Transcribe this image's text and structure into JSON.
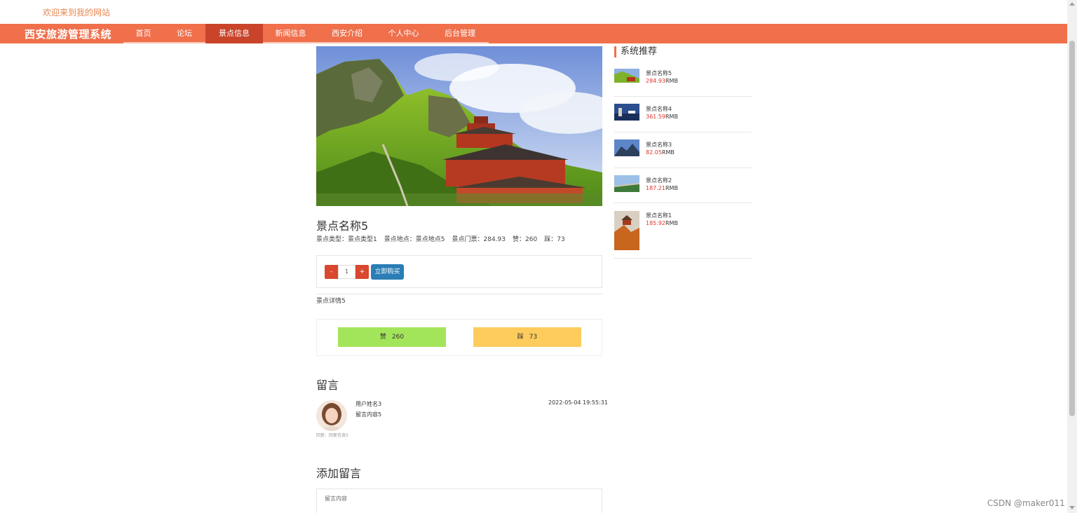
{
  "header": {
    "welcome": "欢迎来到我的网站",
    "brand": "西安旅游管理系统"
  },
  "nav": {
    "items": [
      {
        "label": "首页",
        "width": 57
      },
      {
        "label": "论坛",
        "width": 60
      },
      {
        "label": "景点信息",
        "width": 82,
        "active": true
      },
      {
        "label": "新闻信息",
        "width": 79
      },
      {
        "label": "西安介绍",
        "width": 82
      },
      {
        "label": "个人中心",
        "width": 79
      },
      {
        "label": "后台管理",
        "width": 82
      }
    ]
  },
  "spot": {
    "title": "景点名称5",
    "type_label": "景点类型：",
    "type_value": "景点类型1",
    "location_label": "景点地点：",
    "location_value": "景点地点5",
    "ticket_label": "景点门票：",
    "ticket_value": "284.93",
    "like_label": "赞：",
    "like_value": "260",
    "dislike_label": "踩：",
    "dislike_value": "73",
    "detail": "景点详情5"
  },
  "buy": {
    "minus": "-",
    "qty": "1",
    "plus": "+",
    "buy_label": "立即购买"
  },
  "vote": {
    "like_label": "赞",
    "like_count": "260",
    "dislike_label": "踩",
    "dislike_count": "73"
  },
  "comments": {
    "heading": "留言",
    "items": [
      {
        "user": "用户姓名3",
        "content": "留言内容5",
        "time": "2022-05-04 19:55:31",
        "reply": "回复：回复信息5"
      }
    ]
  },
  "add_comment": {
    "heading": "添加留言",
    "placeholder": "留言内容"
  },
  "sidebar": {
    "heading": "系统推荐",
    "items": [
      {
        "name": "景点名称5",
        "price": "284.93",
        "unit": "RMB",
        "thumb": "mountain-temple"
      },
      {
        "name": "景点名称4",
        "price": "361.59",
        "unit": "RMB",
        "thumb": "tower-sky"
      },
      {
        "name": "景点名称3",
        "price": "82.05",
        "unit": "RMB",
        "thumb": "mountain-blue"
      },
      {
        "name": "景点名称2",
        "price": "187.21",
        "unit": "RMB",
        "thumb": "great-wall"
      },
      {
        "name": "景点名称1",
        "price": "185.92",
        "unit": "RMB",
        "thumb": "cliff-pavilion"
      }
    ]
  },
  "watermark": "CSDN @maker011",
  "colors": {
    "nav_bg": "#f0704c",
    "nav_active": "#c9442b",
    "welcome": "#e8854f",
    "buy_btn": "#2a7db5",
    "qty_btn": "#d9472f",
    "like_btn": "#a3e55a",
    "dislike_btn": "#fdcc5c",
    "price": "#e3342f"
  }
}
